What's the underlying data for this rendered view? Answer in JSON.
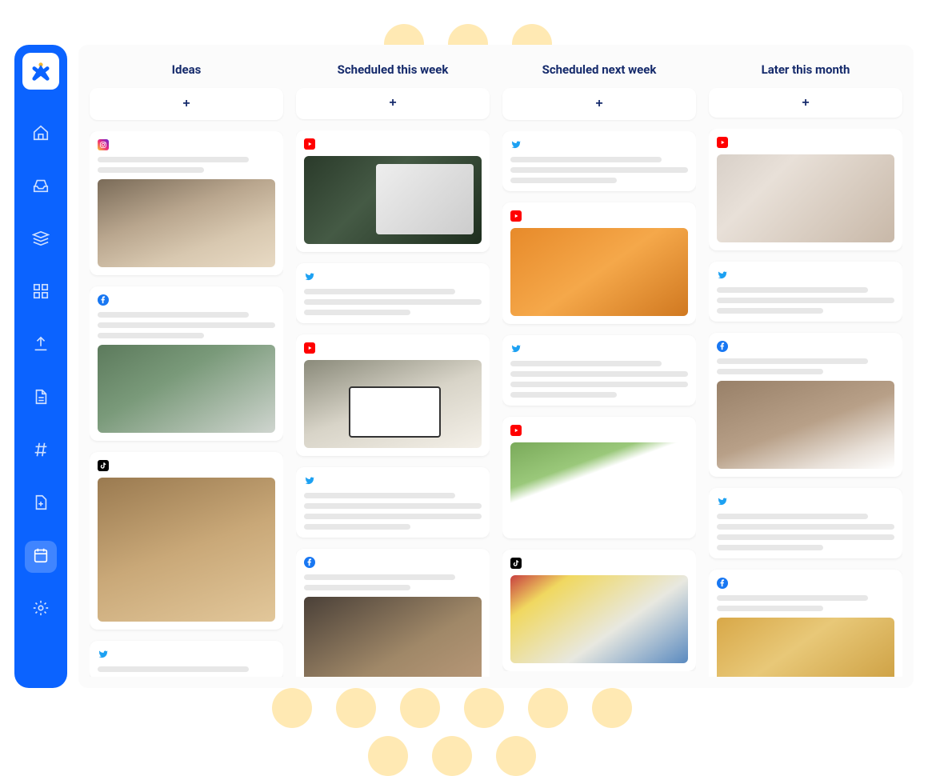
{
  "sidebar": {
    "items": [
      {
        "name": "home",
        "active": false
      },
      {
        "name": "inbox",
        "active": false
      },
      {
        "name": "library",
        "active": false
      },
      {
        "name": "apps",
        "active": false
      },
      {
        "name": "upload",
        "active": false
      },
      {
        "name": "document",
        "active": false
      },
      {
        "name": "hashtag",
        "active": false
      },
      {
        "name": "new-page",
        "active": false
      },
      {
        "name": "calendar",
        "active": true
      },
      {
        "name": "settings",
        "active": false
      }
    ]
  },
  "board": {
    "columns": [
      {
        "title": "Ideas",
        "add_label": "+",
        "cards": [
          {
            "platform": "instagram",
            "lines": 2,
            "image": "coolers",
            "img_h": "tall"
          },
          {
            "platform": "facebook",
            "lines": 3,
            "image": "backpack",
            "img_h": "tall"
          },
          {
            "platform": "tiktok",
            "lines": 0,
            "image": "truckbed",
            "img_h": "xtall"
          },
          {
            "platform": "twitter",
            "lines": 0,
            "image": null
          }
        ]
      },
      {
        "title": "Scheduled this week",
        "add_label": "+",
        "cards": [
          {
            "platform": "youtube",
            "lines": 0,
            "image": "cans",
            "img_h": "tall"
          },
          {
            "platform": "twitter",
            "lines": 3,
            "image": null
          },
          {
            "platform": "youtube",
            "lines": 0,
            "image": "rockscooler",
            "img_h": "tall"
          },
          {
            "platform": "twitter",
            "lines": 4,
            "image": null
          },
          {
            "platform": "facebook",
            "lines": 2,
            "image": "canyon",
            "img_h": "tall"
          }
        ]
      },
      {
        "title": "Scheduled next week",
        "add_label": "+",
        "cards": [
          {
            "platform": "twitter",
            "lines": 3,
            "image": null
          },
          {
            "platform": "youtube",
            "lines": 0,
            "image": "drink",
            "img_h": "tall"
          },
          {
            "platform": "twitter",
            "lines": 4,
            "image": null
          },
          {
            "platform": "youtube",
            "lines": 0,
            "image": "whitecooler",
            "img_h": "tall"
          },
          {
            "platform": "tiktok",
            "lines": 0,
            "image": "coolerkayak",
            "img_h": "tall"
          }
        ]
      },
      {
        "title": "Later this month",
        "add_label": "+",
        "cards": [
          {
            "platform": "youtube",
            "lines": 0,
            "image": "truly",
            "img_h": "tall"
          },
          {
            "platform": "twitter",
            "lines": 3,
            "image": null
          },
          {
            "platform": "facebook",
            "lines": 2,
            "image": "boat",
            "img_h": "tall"
          },
          {
            "platform": "twitter",
            "lines": 4,
            "image": null
          },
          {
            "platform": "facebook",
            "lines": 2,
            "image": "stickers",
            "img_h": "tall"
          }
        ]
      }
    ]
  },
  "colors": {
    "brand_blue": "#0b63ff",
    "title_navy": "#152a6b"
  }
}
